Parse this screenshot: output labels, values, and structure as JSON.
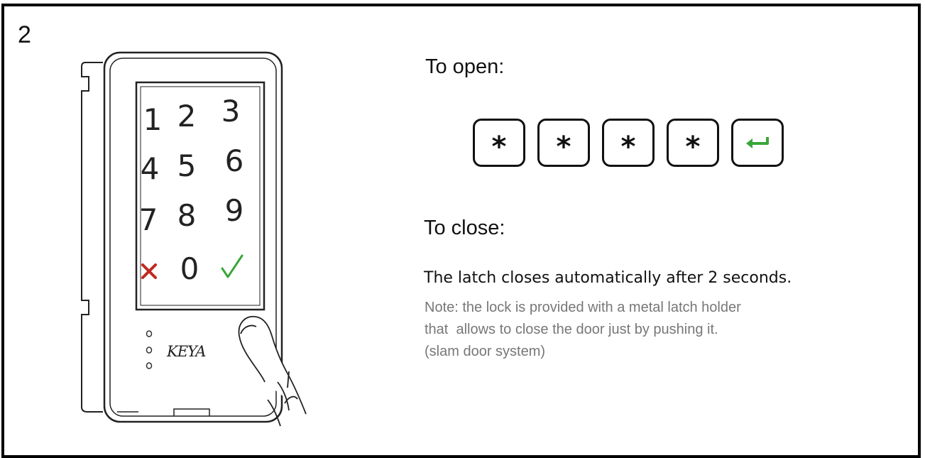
{
  "step_number": "2",
  "keypad": {
    "digits": [
      "1",
      "2",
      "3",
      "4",
      "5",
      "6",
      "7",
      "8",
      "9",
      "0"
    ],
    "cancel_icon": "x-icon",
    "confirm_icon": "checkmark-icon",
    "brand": "KEYA",
    "colors": {
      "cancel": "#c0281e",
      "confirm": "#3aa63a"
    }
  },
  "open": {
    "heading": "To open:",
    "sequence": [
      "*",
      "*",
      "*",
      "*"
    ],
    "enter_icon": "enter-arrow-icon",
    "enter_color": "#3aa63a"
  },
  "close": {
    "heading": "To close:",
    "latch_text": "The latch closes automatically after 2 seconds.",
    "note_lines": [
      "Note: the lock is provided with a metal latch holder",
      "that  allows to close the door just by pushing it.",
      "(slam door system)"
    ]
  }
}
